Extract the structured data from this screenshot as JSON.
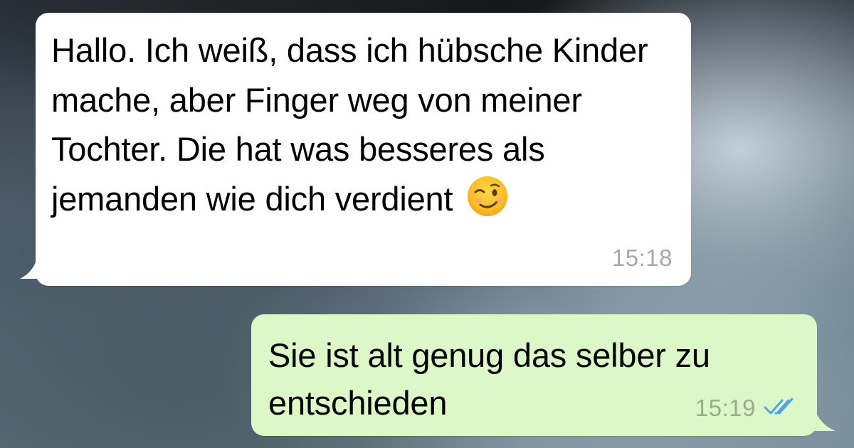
{
  "conversation": {
    "messages": [
      {
        "direction": "incoming",
        "text": "Hallo. Ich weiß, dass ich hübsche Kinder mache, aber Finger weg von meiner Tochter. Die hat was besseres als jemanden wie dich verdient",
        "emoji": "winking-face",
        "time": "15:18"
      },
      {
        "direction": "outgoing",
        "text": "Sie ist alt genug das selber zu entschieden",
        "time": "15:19",
        "status": "read",
        "status_icon": "double-check-icon"
      }
    ]
  },
  "colors": {
    "incoming_bubble": "#ffffff",
    "outgoing_bubble": "#dcf8c6",
    "read_ticks": "#4fa3e8",
    "timestamp": "#a7a9a6"
  }
}
